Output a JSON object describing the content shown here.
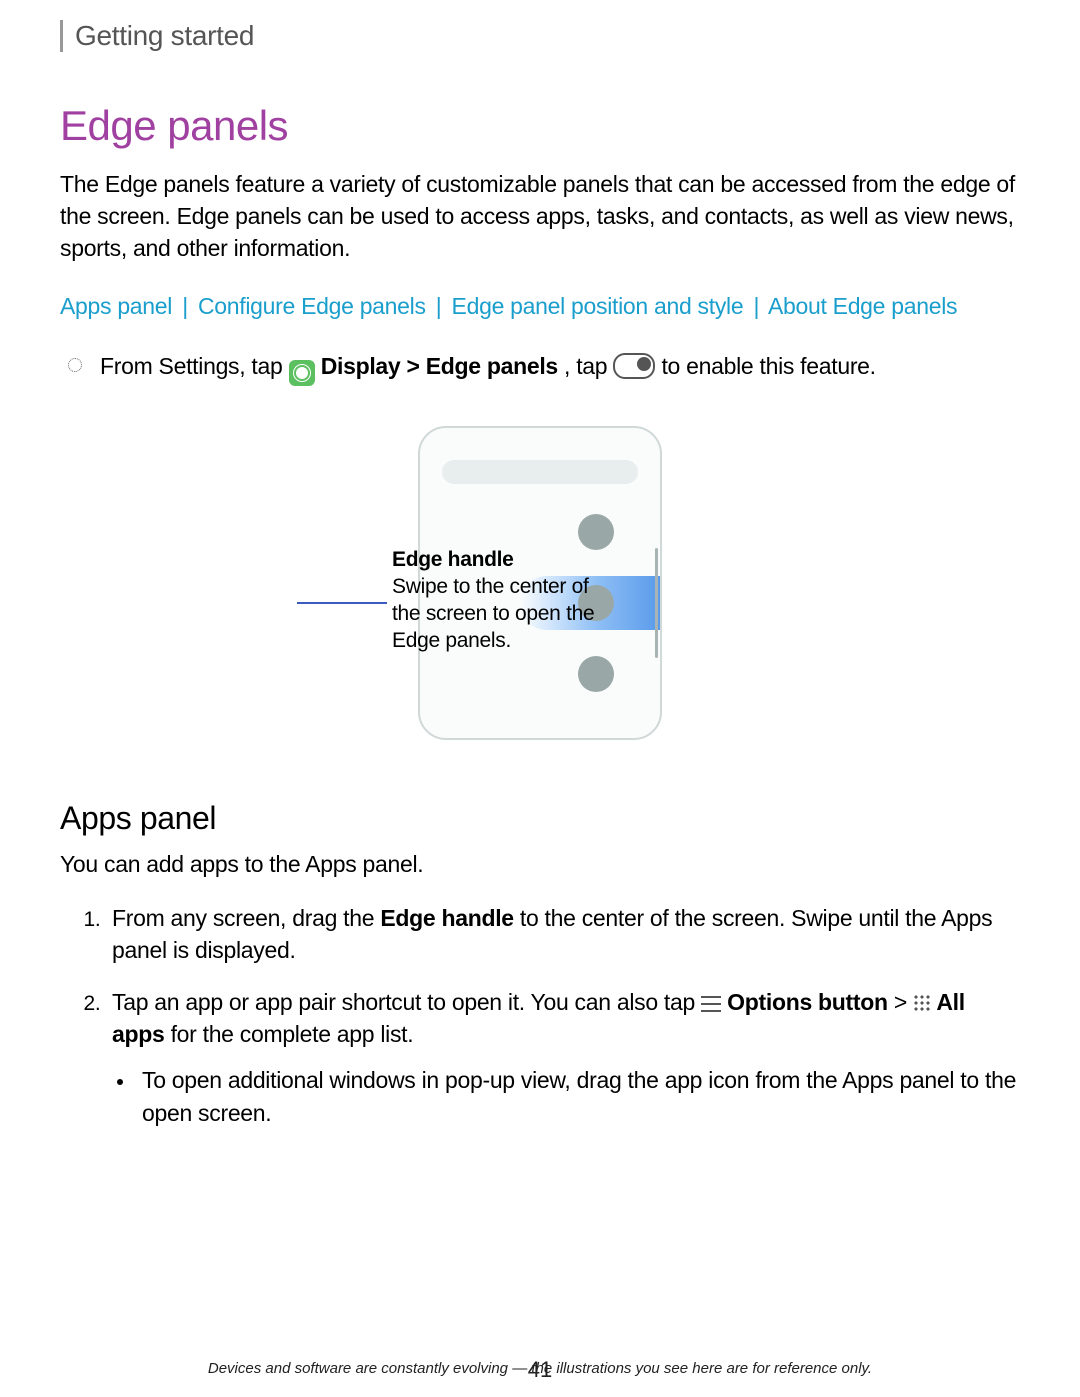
{
  "breadcrumb": "Getting started",
  "title": "Edge panels",
  "intro": "The Edge panels feature a variety of customizable panels that can be accessed from the edge of the screen. Edge panels can be used to access apps, tasks, and contacts, as well as view news, sports, and other information.",
  "links": {
    "a": "Apps panel",
    "b": "Configure Edge panels",
    "c": "Edge panel position and style",
    "d": "About Edge panels",
    "sep": "|"
  },
  "instruction": {
    "pre": "From Settings, tap ",
    "display_edge": " Display > Edge panels",
    "tap": ", tap ",
    "post": " to enable this feature."
  },
  "callout": {
    "title": "Edge handle",
    "body": "Swipe to the center of the screen to open the Edge panels."
  },
  "subtitle": "Apps panel",
  "subintro": "You can add apps to the Apps panel.",
  "step1": {
    "pre": "From any screen, drag the ",
    "bold": "Edge handle",
    "post": " to the center of the screen. Swipe until the Apps panel is displayed."
  },
  "step2": {
    "pre": "Tap an app or app pair shortcut to open it. You can also tap ",
    "options": " Options button",
    "gt": " > ",
    "allapps": " All apps",
    "post": " for the complete app list."
  },
  "step2sub": "To open additional windows in pop-up view, drag the app icon from the Apps panel to the open screen.",
  "footer": "Devices and software are constantly evolving — the illustrations you see here are for reference only.",
  "pagenum": "41"
}
